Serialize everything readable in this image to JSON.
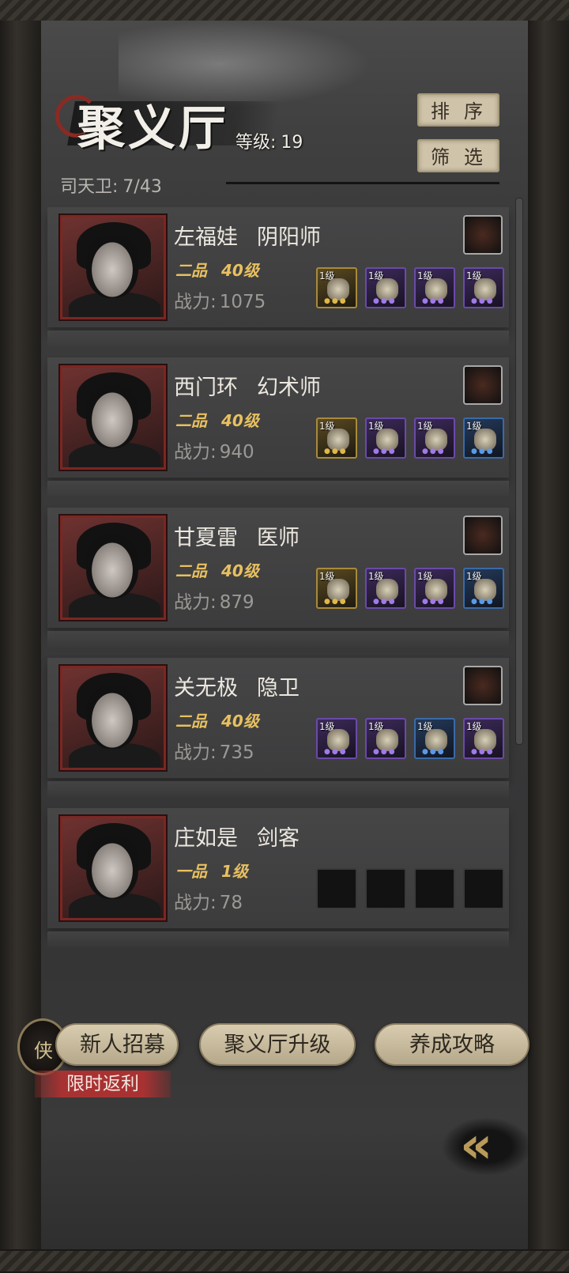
{
  "header": {
    "title": "聚义厅",
    "level_label": "等级:",
    "level_value": "19",
    "sort_label": "排序",
    "filter_label": "筛选",
    "guard_label": "司天卫:",
    "guard_count": "7/43"
  },
  "roster": [
    {
      "name": "左福娃",
      "role": "阴阳师",
      "rank": "二品",
      "level": "40级",
      "power_label": "战力:",
      "power": "1075",
      "skill_icon": "fan-skill-icon",
      "equipment": [
        {
          "level": "1级",
          "quality": "gold",
          "icon": "weapon-icon"
        },
        {
          "level": "1级",
          "quality": "purple",
          "icon": "armor-icon"
        },
        {
          "level": "1级",
          "quality": "purple",
          "icon": "orb-icon"
        },
        {
          "level": "1级",
          "quality": "purple",
          "icon": "boot-icon"
        }
      ]
    },
    {
      "name": "西门环",
      "role": "幻术师",
      "rank": "二品",
      "level": "40级",
      "power_label": "战力:",
      "power": "940",
      "skill_icon": "gem-skill-icon",
      "equipment": [
        {
          "level": "1级",
          "quality": "gold",
          "icon": "weapon-icon"
        },
        {
          "level": "1级",
          "quality": "purple",
          "icon": "armor-icon"
        },
        {
          "level": "1级",
          "quality": "purple",
          "icon": "coin-icon"
        },
        {
          "level": "1级",
          "quality": "blue",
          "icon": "disc-icon"
        }
      ]
    },
    {
      "name": "甘夏雷",
      "role": "医师",
      "rank": "二品",
      "level": "40级",
      "power_label": "战力:",
      "power": "879",
      "skill_icon": "hook-skill-icon",
      "equipment": [
        {
          "level": "1级",
          "quality": "gold",
          "icon": "gourd-icon"
        },
        {
          "level": "1级",
          "quality": "purple",
          "icon": "armor-icon"
        },
        {
          "level": "1级",
          "quality": "purple",
          "icon": "jade-icon"
        },
        {
          "level": "1级",
          "quality": "blue",
          "icon": "pouch-icon"
        }
      ]
    },
    {
      "name": "关无极",
      "role": "隐卫",
      "rank": "二品",
      "level": "40级",
      "power_label": "战力:",
      "power": "735",
      "skill_icon": "blade-skill-icon",
      "equipment": [
        {
          "level": "1级",
          "quality": "purple",
          "icon": "dart-icon"
        },
        {
          "level": "1级",
          "quality": "purple",
          "icon": "armor-icon"
        },
        {
          "level": "1级",
          "quality": "blue",
          "icon": "vase-icon"
        },
        {
          "level": "1级",
          "quality": "purple",
          "icon": "scepter-icon"
        }
      ]
    },
    {
      "name": "庄如是",
      "role": "剑客",
      "rank": "一品",
      "level": "1级",
      "power_label": "战力:",
      "power": "78",
      "skill_icon": null,
      "equipment": [
        {
          "level": "",
          "quality": "empty",
          "icon": "empty-slot"
        },
        {
          "level": "",
          "quality": "empty",
          "icon": "empty-slot"
        },
        {
          "level": "",
          "quality": "empty",
          "icon": "empty-slot"
        },
        {
          "level": "",
          "quality": "empty",
          "icon": "empty-slot"
        }
      ]
    }
  ],
  "footer": {
    "recruit_label": "新人招募",
    "recruit_icon_glyph": "侠",
    "promo_label": "限时返利",
    "upgrade_label": "聚义厅升级",
    "guide_label": "养成攻略",
    "back_glyph": "«"
  },
  "colors": {
    "rank_gold": "#e8c060",
    "portrait_border": "#7a2723",
    "button_beige": "#cfc3a9",
    "promo_red": "#a83232"
  }
}
